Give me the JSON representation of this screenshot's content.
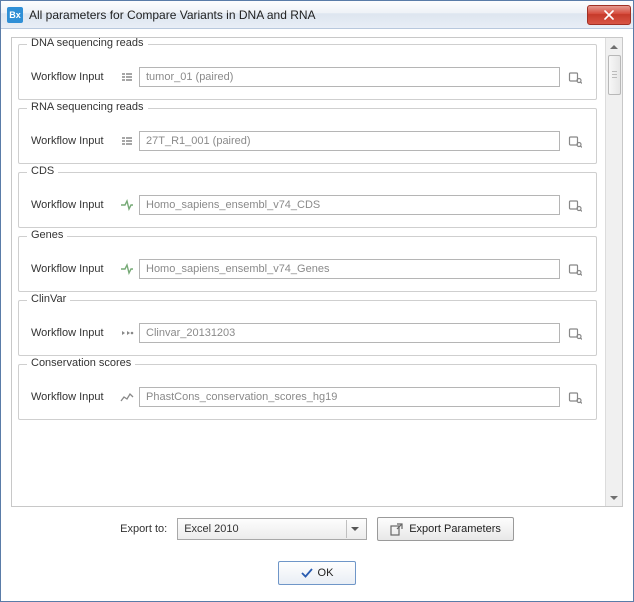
{
  "window": {
    "title": "All parameters for Compare Variants in DNA and RNA",
    "app_badge": "Bx"
  },
  "sections": {
    "dna": {
      "title": "DNA sequencing reads",
      "label": "Workflow Input",
      "value": "tumor_01 (paired)"
    },
    "rna": {
      "title": "RNA sequencing reads",
      "label": "Workflow Input",
      "value": "27T_R1_001 (paired)"
    },
    "cds": {
      "title": "CDS",
      "label": "Workflow Input",
      "value": "Homo_sapiens_ensembl_v74_CDS"
    },
    "genes": {
      "title": "Genes",
      "label": "Workflow Input",
      "value": "Homo_sapiens_ensembl_v74_Genes"
    },
    "clinvar": {
      "title": "ClinVar",
      "label": "Workflow Input",
      "value": "Clinvar_20131203"
    },
    "conservation": {
      "title": "Conservation scores",
      "label": "Workflow Input",
      "value": "PhastCons_conservation_scores_hg19"
    }
  },
  "export": {
    "label": "Export to:",
    "selected": "Excel 2010",
    "button": "Export Parameters"
  },
  "ok": {
    "label": "OK"
  }
}
